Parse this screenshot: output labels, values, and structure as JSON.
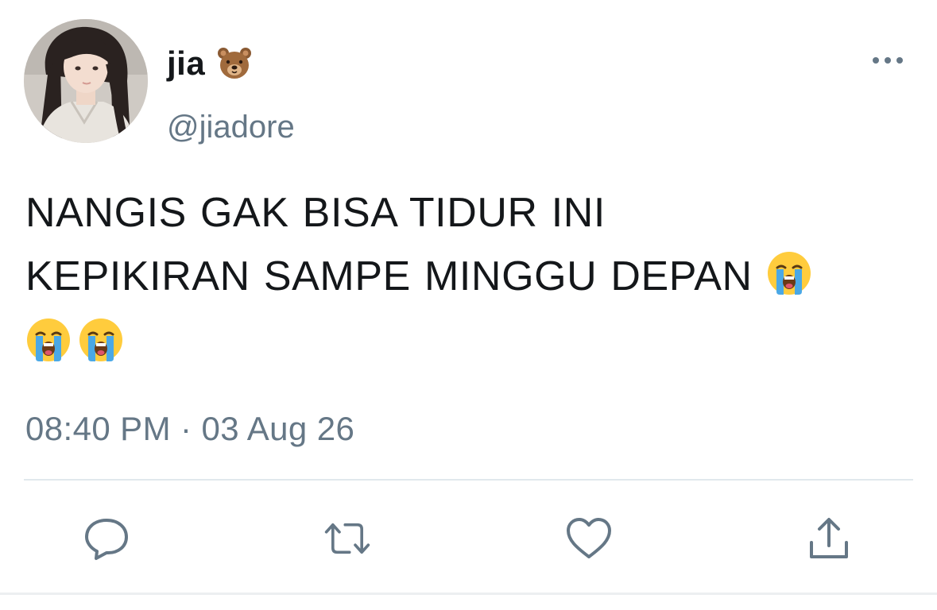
{
  "user": {
    "display_name": "jia",
    "name_emoji": "bear-face",
    "handle": "@jiadore"
  },
  "tweet": {
    "line1": "NANGIS GAK BISA TIDUR INI",
    "line2": "KEPIKIRAN SAMPE MINGGU DEPAN",
    "emojis": [
      "loudly-crying-face",
      "loudly-crying-face",
      "loudly-crying-face"
    ],
    "timestamp": "08:40 PM · 03 Aug 26"
  },
  "actions": [
    "reply-icon",
    "retweet-icon",
    "like-icon",
    "share-icon"
  ],
  "colors": {
    "text": "#14171a",
    "secondary": "#657786",
    "divider": "#e1e8ed"
  }
}
